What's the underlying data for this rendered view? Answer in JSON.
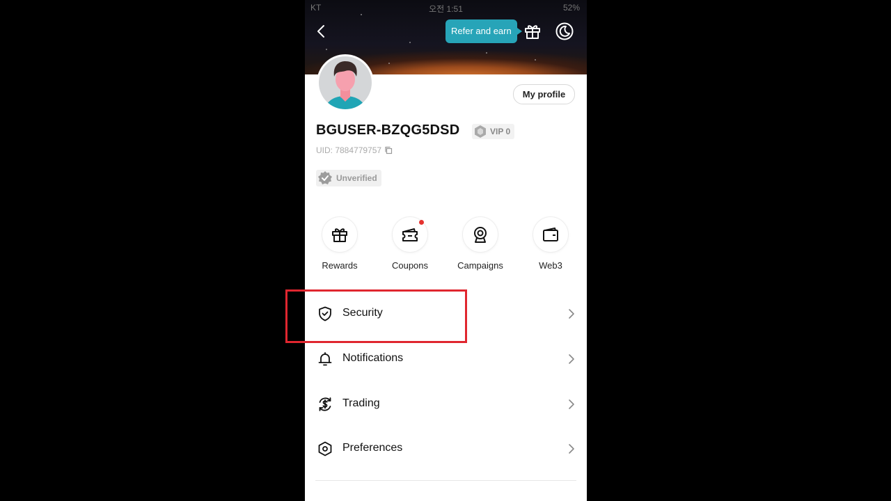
{
  "status_bar": {
    "carrier": "KT",
    "time": "오전 1:51",
    "battery": "52%"
  },
  "header": {
    "refer_label": "Refer and earn"
  },
  "profile": {
    "my_profile_label": "My profile",
    "username": "BGUSER-BZQG5DSD",
    "vip_label": "VIP 0",
    "uid_label": "UID: 7884779757",
    "verification_label": "Unverified"
  },
  "shortcuts": [
    {
      "label": "Rewards",
      "icon": "gift-icon"
    },
    {
      "label": "Coupons",
      "icon": "coupon-icon",
      "has_badge": true
    },
    {
      "label": "Campaigns",
      "icon": "medal-icon"
    },
    {
      "label": "Web3",
      "icon": "wallet-icon"
    }
  ],
  "menu": [
    {
      "label": "Security",
      "icon": "shield-check-icon"
    },
    {
      "label": "Notifications",
      "icon": "bell-icon"
    },
    {
      "label": "Trading",
      "icon": "dollar-exchange-icon"
    },
    {
      "label": "Preferences",
      "icon": "hexagon-settings-icon"
    }
  ],
  "colors": {
    "accent": "#27a4b8",
    "highlight": "#e0262f",
    "badge": "#e5322f"
  }
}
